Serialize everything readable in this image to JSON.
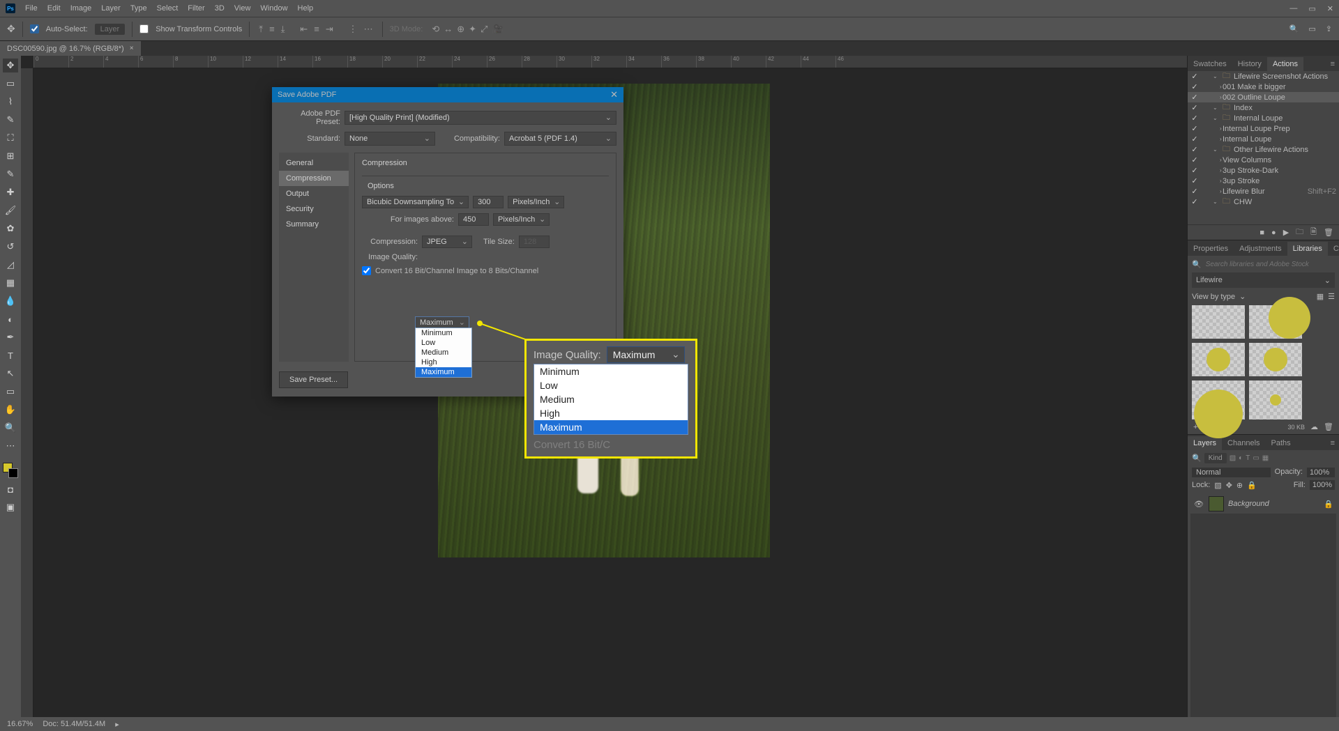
{
  "menubar": {
    "items": [
      "File",
      "Edit",
      "Image",
      "Layer",
      "Type",
      "Select",
      "Filter",
      "3D",
      "View",
      "Window",
      "Help"
    ]
  },
  "optbar": {
    "auto_select": "Auto-Select:",
    "layer": "Layer",
    "show_tc": "Show Transform Controls",
    "mode3d": "3D Mode:"
  },
  "tab": {
    "title": "DSC00590.jpg @ 16.7% (RGB/8*)"
  },
  "panels": {
    "swatches": "Swatches",
    "history": "History",
    "actions": "Actions",
    "properties": "Properties",
    "adjustments": "Adjustments",
    "libraries": "Libraries",
    "color": "Color",
    "layers": "Layers",
    "channels": "Channels",
    "paths": "Paths"
  },
  "actions": {
    "items": [
      {
        "indent": 0,
        "folder": true,
        "name": "Lifewire Screenshot Actions"
      },
      {
        "indent": 1,
        "name": "001 Make it bigger"
      },
      {
        "indent": 1,
        "name": "002 Outline Loupe",
        "sel": true
      },
      {
        "indent": 0,
        "folder": true,
        "name": "Index"
      },
      {
        "indent": 0,
        "folder": true,
        "name": "Internal Loupe"
      },
      {
        "indent": 1,
        "name": "Internal Loupe Prep"
      },
      {
        "indent": 1,
        "name": "Internal Loupe"
      },
      {
        "indent": 0,
        "folder": true,
        "name": "Other Lifewire Actions"
      },
      {
        "indent": 1,
        "name": "View Columns"
      },
      {
        "indent": 1,
        "name": "3up Stroke-Dark"
      },
      {
        "indent": 1,
        "name": "3up Stroke"
      },
      {
        "indent": 1,
        "name": "Lifewire Blur",
        "kb": "Shift+F2"
      },
      {
        "indent": 0,
        "folder": true,
        "name": "CHW"
      }
    ]
  },
  "libraries": {
    "search_ph": "Search libraries and Adobe Stock",
    "current": "Lifewire",
    "viewby": "View by type",
    "size": "30 KB"
  },
  "layers": {
    "kind": "Kind",
    "normal": "Normal",
    "opacity": "Opacity:",
    "op_val": "100%",
    "lock": "Lock:",
    "fill": "Fill:",
    "fill_val": "100%",
    "bg": "Background"
  },
  "status": {
    "zoom": "16.67%",
    "doc": "Doc: 51.4M/51.4M"
  },
  "dialog": {
    "title": "Save Adobe PDF",
    "preset_lbl": "Adobe PDF Preset:",
    "preset_val": "[High Quality Print] (Modified)",
    "std_lbl": "Standard:",
    "std_val": "None",
    "compat_lbl": "Compatibility:",
    "compat_val": "Acrobat 5 (PDF 1.4)",
    "nav": [
      "General",
      "Compression",
      "Output",
      "Security",
      "Summary"
    ],
    "nav_active": "Compression",
    "pane_title": "Compression",
    "options": "Options",
    "downsample": "Bicubic Downsampling To",
    "ds_val": "300",
    "ds_unit": "Pixels/Inch",
    "above_lbl": "For images above:",
    "above_val": "450",
    "above_unit": "Pixels/Inch",
    "comp_lbl": "Compression:",
    "comp_val": "JPEG",
    "tile_lbl": "Tile Size:",
    "tile_val": "128",
    "iq_lbl": "Image Quality:",
    "iq_val": "Maximum",
    "iq_opts": [
      "Minimum",
      "Low",
      "Medium",
      "High",
      "Maximum"
    ],
    "convert": "Convert 16 Bit/Channel Image to 8 Bits/Channel",
    "save_preset": "Save Preset..."
  },
  "loupe": {
    "iq_lbl": "Image Quality:",
    "iq_val": "Maximum",
    "convert": "Convert 16 Bit/C",
    "opts": [
      "Minimum",
      "Low",
      "Medium",
      "High",
      "Maximum"
    ]
  }
}
